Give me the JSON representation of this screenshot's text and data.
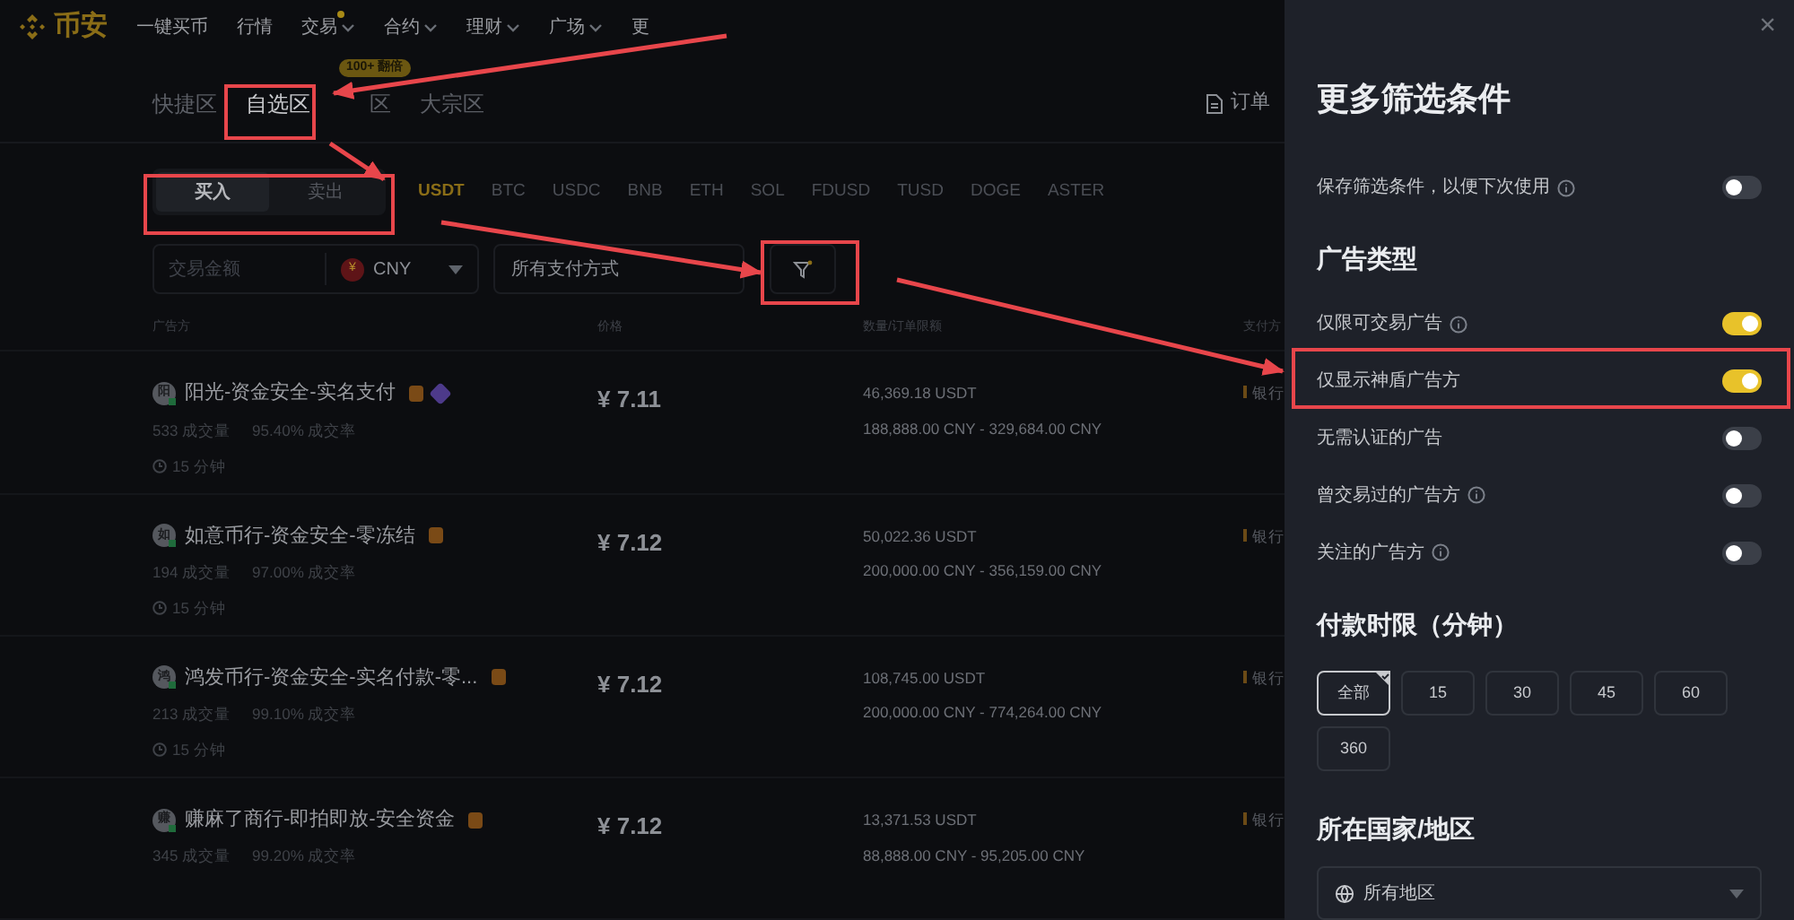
{
  "logo": {
    "text": "币安"
  },
  "nav": [
    {
      "label": "一键买币",
      "dropdown": false,
      "dot": false
    },
    {
      "label": "行情",
      "dropdown": false,
      "dot": false
    },
    {
      "label": "交易",
      "dropdown": true,
      "dot": true
    },
    {
      "label": "合约",
      "dropdown": true,
      "dot": false
    },
    {
      "label": "理财",
      "dropdown": true,
      "dot": false
    },
    {
      "label": "广场",
      "dropdown": true,
      "dot": false
    },
    {
      "label": "更",
      "dropdown": false,
      "dot": false
    }
  ],
  "zone_tabs": [
    {
      "label": "快捷区",
      "selected": false
    },
    {
      "label": "自选区",
      "selected": true
    },
    {
      "label": "区",
      "selected": false,
      "badge": "100+ 翻倍"
    },
    {
      "label": "大宗区",
      "selected": false
    }
  ],
  "orders_link": "订单",
  "side_tabs": [
    {
      "label": "买入",
      "selected": true
    },
    {
      "label": "卖出",
      "selected": false
    }
  ],
  "coins": [
    {
      "label": "USDT",
      "selected": true
    },
    {
      "label": "BTC",
      "selected": false
    },
    {
      "label": "USDC",
      "selected": false
    },
    {
      "label": "BNB",
      "selected": false
    },
    {
      "label": "ETH",
      "selected": false
    },
    {
      "label": "SOL",
      "selected": false
    },
    {
      "label": "FDUSD",
      "selected": false
    },
    {
      "label": "TUSD",
      "selected": false
    },
    {
      "label": "DOGE",
      "selected": false
    },
    {
      "label": "ASTER",
      "selected": false
    }
  ],
  "amount_field": {
    "placeholder": "交易金额"
  },
  "currency_select": {
    "value": "CNY",
    "icon_text": "¥"
  },
  "payment_select": {
    "value": "所有支付方式"
  },
  "table": {
    "columns": [
      "广告方",
      "价格",
      "数量/订单限额",
      "支付方"
    ],
    "rows": [
      {
        "avatar": "阳",
        "name": "阳光-资金安全-实名支付",
        "verified": true,
        "trades": "533 成交量",
        "rate": "95.40% 成交率",
        "time": "15 分钟",
        "price": "¥ 7.11",
        "amount": "46,369.18 USDT",
        "limit": "188,888.00 CNY - 329,684.00 CNY",
        "payment": "银行"
      },
      {
        "avatar": "如",
        "name": "如意币行-资金安全-零冻结",
        "verified": false,
        "trades": "194 成交量",
        "rate": "97.00% 成交率",
        "time": "15 分钟",
        "price": "¥ 7.12",
        "amount": "50,022.36 USDT",
        "limit": "200,000.00 CNY - 356,159.00 CNY",
        "payment": "银行"
      },
      {
        "avatar": "鸿",
        "name": "鸿发币行-资金安全-实名付款-零...",
        "verified": false,
        "trades": "213 成交量",
        "rate": "99.10% 成交率",
        "time": "15 分钟",
        "price": "¥ 7.12",
        "amount": "108,745.00 USDT",
        "limit": "200,000.00 CNY - 774,264.00 CNY",
        "payment": "银行"
      },
      {
        "avatar": "赚",
        "name": "赚麻了商行-即拍即放-安全资金",
        "verified": false,
        "trades": "345 成交量",
        "rate": "99.20% 成交率",
        "time": "",
        "price": "¥ 7.12",
        "amount": "13,371.53 USDT",
        "limit": "88,888.00 CNY - 95,205.00 CNY",
        "payment": "银行"
      }
    ]
  },
  "panel": {
    "close": "×",
    "title": "更多筛选条件",
    "save_option": {
      "label": "保存筛选条件，以便下次使用",
      "info": true,
      "on": false
    },
    "ad_type": {
      "title": "广告类型",
      "options": [
        {
          "label": "仅限可交易广告",
          "info": true,
          "on": true
        },
        {
          "label": "仅显示神盾广告方",
          "info": false,
          "on": true
        },
        {
          "label": "无需认证的广告",
          "info": false,
          "on": false
        },
        {
          "label": "曾交易过的广告方",
          "info": true,
          "on": false
        },
        {
          "label": "关注的广告方",
          "info": true,
          "on": false
        }
      ]
    },
    "time_limit": {
      "title": "付款时限（分钟）",
      "options": [
        {
          "label": "全部",
          "selected": true
        },
        {
          "label": "15",
          "selected": false
        },
        {
          "label": "30",
          "selected": false
        },
        {
          "label": "45",
          "selected": false
        },
        {
          "label": "60",
          "selected": false
        },
        {
          "label": "360",
          "selected": false
        }
      ]
    },
    "region": {
      "title": "所在国家/地区",
      "value": "所有地区"
    }
  }
}
